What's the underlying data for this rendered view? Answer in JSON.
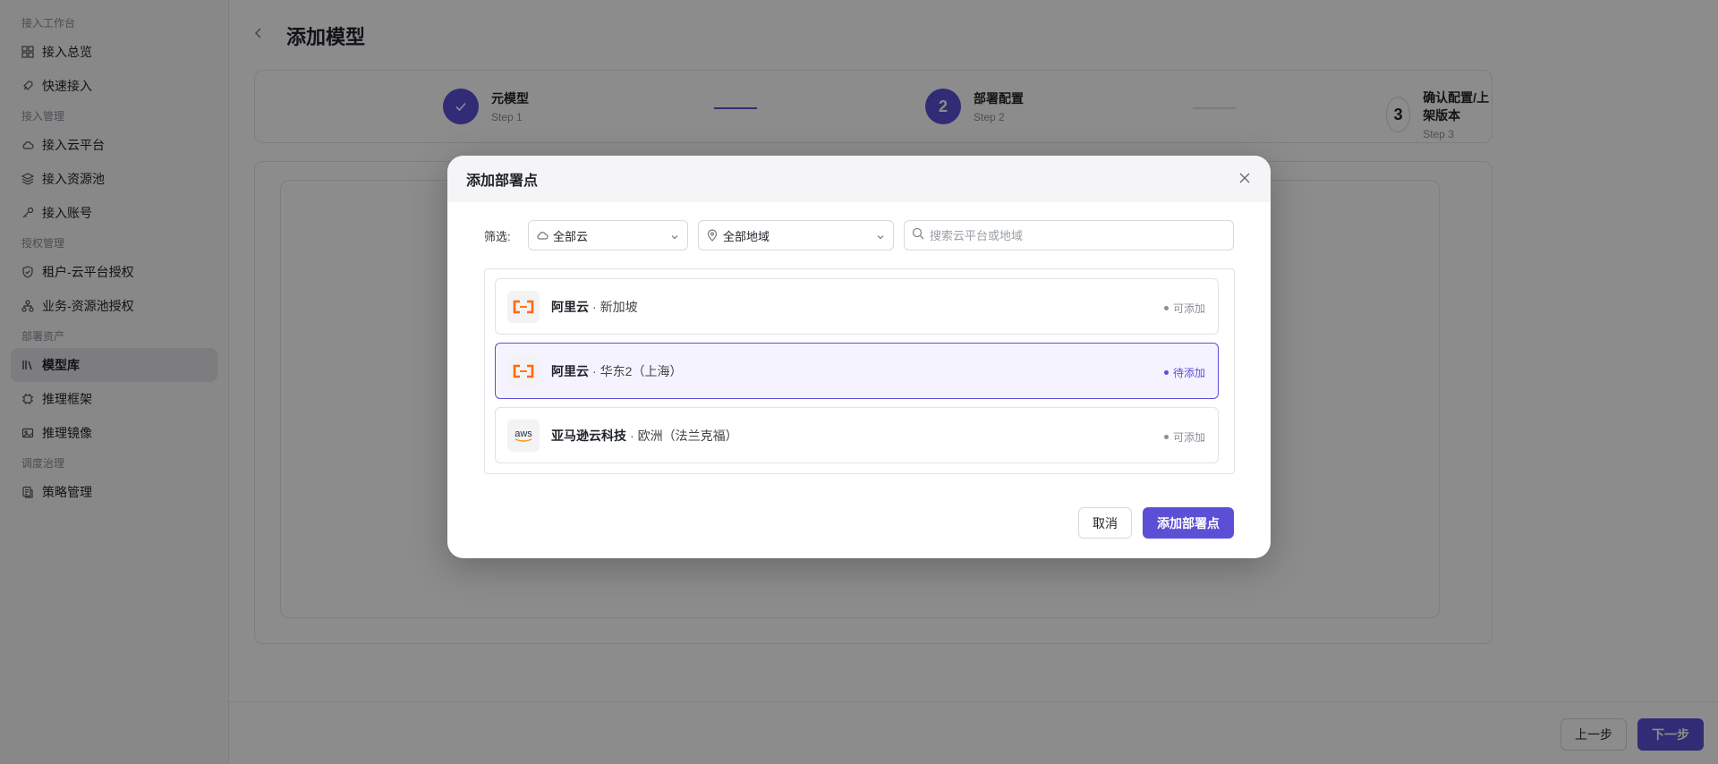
{
  "sidebar": {
    "sections": [
      {
        "label": "接入工作台"
      },
      {
        "label": "接入管理"
      },
      {
        "label": "授权管理"
      },
      {
        "label": "部署资产"
      },
      {
        "label": "调度治理"
      }
    ],
    "items": [
      {
        "label": "接入总览",
        "icon": "grid-icon"
      },
      {
        "label": "快速接入",
        "icon": "rocket-icon"
      },
      {
        "label": "接入云平台",
        "icon": "cloud-icon"
      },
      {
        "label": "接入资源池",
        "icon": "layers-icon"
      },
      {
        "label": "接入账号",
        "icon": "key-icon"
      },
      {
        "label": "租户-云平台授权",
        "icon": "shield-check-icon"
      },
      {
        "label": "业务-资源池授权",
        "icon": "hierarchy-icon"
      },
      {
        "label": "模型库",
        "icon": "library-icon",
        "active": true
      },
      {
        "label": "推理框架",
        "icon": "chip-icon"
      },
      {
        "label": "推理镜像",
        "icon": "image-icon"
      },
      {
        "label": "策略管理",
        "icon": "policy-icon"
      }
    ]
  },
  "page": {
    "title": "添加模型",
    "back_icon": "chevron-left-icon"
  },
  "steps": [
    {
      "number": "",
      "title": "元模型",
      "subtitle": "Step 1",
      "state": "done"
    },
    {
      "number": "2",
      "title": "部署配置",
      "subtitle": "Step 2",
      "state": "current"
    },
    {
      "number": "3",
      "title": "确认配置/上架版本",
      "subtitle": "Step 3",
      "state": "pending"
    }
  ],
  "footer": {
    "prev_label": "上一步",
    "next_label": "下一步"
  },
  "modal": {
    "title": "添加部署点",
    "filter_label": "筛选:",
    "cloud_select": "全部云",
    "region_select": "全部地域",
    "search_placeholder": "搜索云平台或地域",
    "items": [
      {
        "provider": "阿里云",
        "region": "新加坡",
        "status": "可添加",
        "logo": "aliyun-logo"
      },
      {
        "provider": "阿里云",
        "region": "华东2（上海）",
        "status": "待添加",
        "logo": "aliyun-logo",
        "selected": true
      },
      {
        "provider": "亚马逊云科技",
        "region": "欧洲（法兰克福）",
        "status": "可添加",
        "logo": "aws-logo"
      }
    ],
    "cancel_label": "取消",
    "confirm_label": "添加部署点"
  },
  "colors": {
    "accent": "#5b4fd6",
    "aliyun": "#ff6a00",
    "status_gray": "#8a8f99"
  }
}
